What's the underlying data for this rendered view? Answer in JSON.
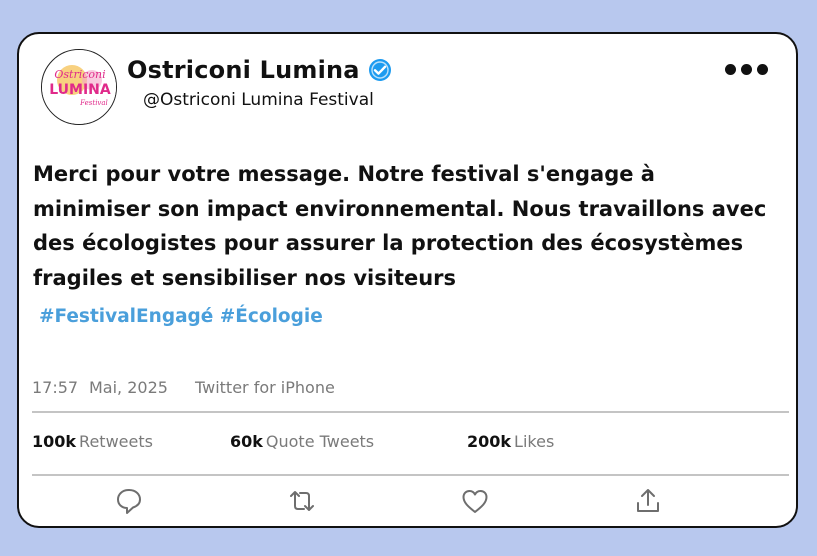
{
  "profile": {
    "name": "Ostriconi Lumina",
    "handle": "@Ostriconi Lumina Festival",
    "logo_text_top": "Ostriconi",
    "logo_text_mid": "LUMINA",
    "logo_text_bottom": "Festival"
  },
  "tweet": {
    "line1": "Merci pour votre message. Notre festival s'engage à",
    "line2": "minimiser son impact environnemental. Nous travaillons avec",
    "line3": "des écologistes pour assurer la protection des écosystèmes",
    "line4": "fragiles et sensibiliser nos visiteurs",
    "hashtags": "#FestivalEngagé #Écologie"
  },
  "meta": {
    "time": "17:57",
    "date": "Mai, 2025",
    "source": "Twitter for iPhone"
  },
  "stats": {
    "retweets_count": "100k",
    "retweets_label": "Retweets",
    "quotes_count": "60k",
    "quotes_label": "Quote Tweets",
    "likes_count": "200k",
    "likes_label": "Likes"
  },
  "colors": {
    "background": "#b8c8ee",
    "hashtag": "#4a9fdb",
    "verified": "#1d9bf0",
    "muted_text": "#7a7a7a",
    "logo_pink": "#e02a8a"
  },
  "icons": {
    "verified": "verified-badge-icon",
    "more": "more-options-icon",
    "reply": "reply-icon",
    "retweet": "retweet-icon",
    "like": "heart-icon",
    "share": "share-icon"
  }
}
